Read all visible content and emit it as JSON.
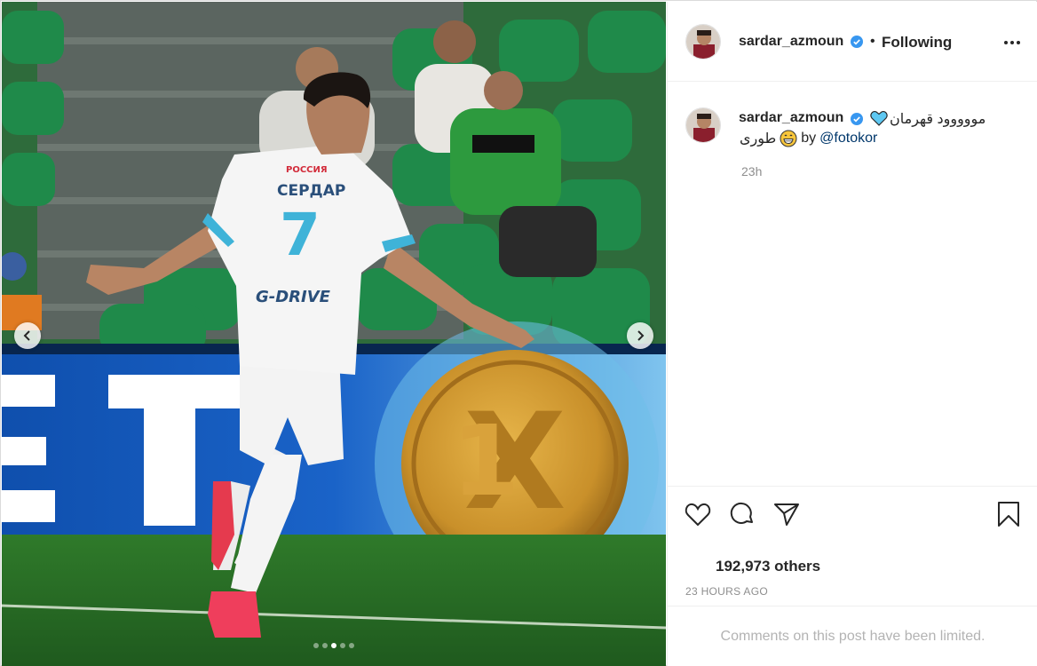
{
  "post": {
    "image_description_name": "footballer-celebrating-photo",
    "carousel": {
      "total": 5,
      "active_index": 2
    }
  },
  "header": {
    "username": "sardar_azmoun",
    "separator": "•",
    "follow_state": "Following"
  },
  "caption": {
    "username": "sardar_azmoun",
    "text_line1": "مووووود قهرمان",
    "text_line2_rtl": "طوری",
    "by_label": "by",
    "mention": "@fotokor",
    "time_short": "23h"
  },
  "actions": {
    "like_icon": "heart-outline-icon",
    "comment_icon": "speech-bubble-icon",
    "share_icon": "paper-plane-icon",
    "save_icon": "bookmark-icon"
  },
  "engagement": {
    "likes_text": "192,973 others",
    "time_long": "23 HOURS AGO"
  },
  "comments": {
    "limited_notice": "Comments on this post have been limited."
  },
  "colors": {
    "verified_blue": "#3897f0",
    "link_blue": "#00376b",
    "muted_gray": "#8e8e8e",
    "stadium_green": "#1f6a2e",
    "board_blue": "#1457b8",
    "coin_gold": "#c9902a"
  }
}
